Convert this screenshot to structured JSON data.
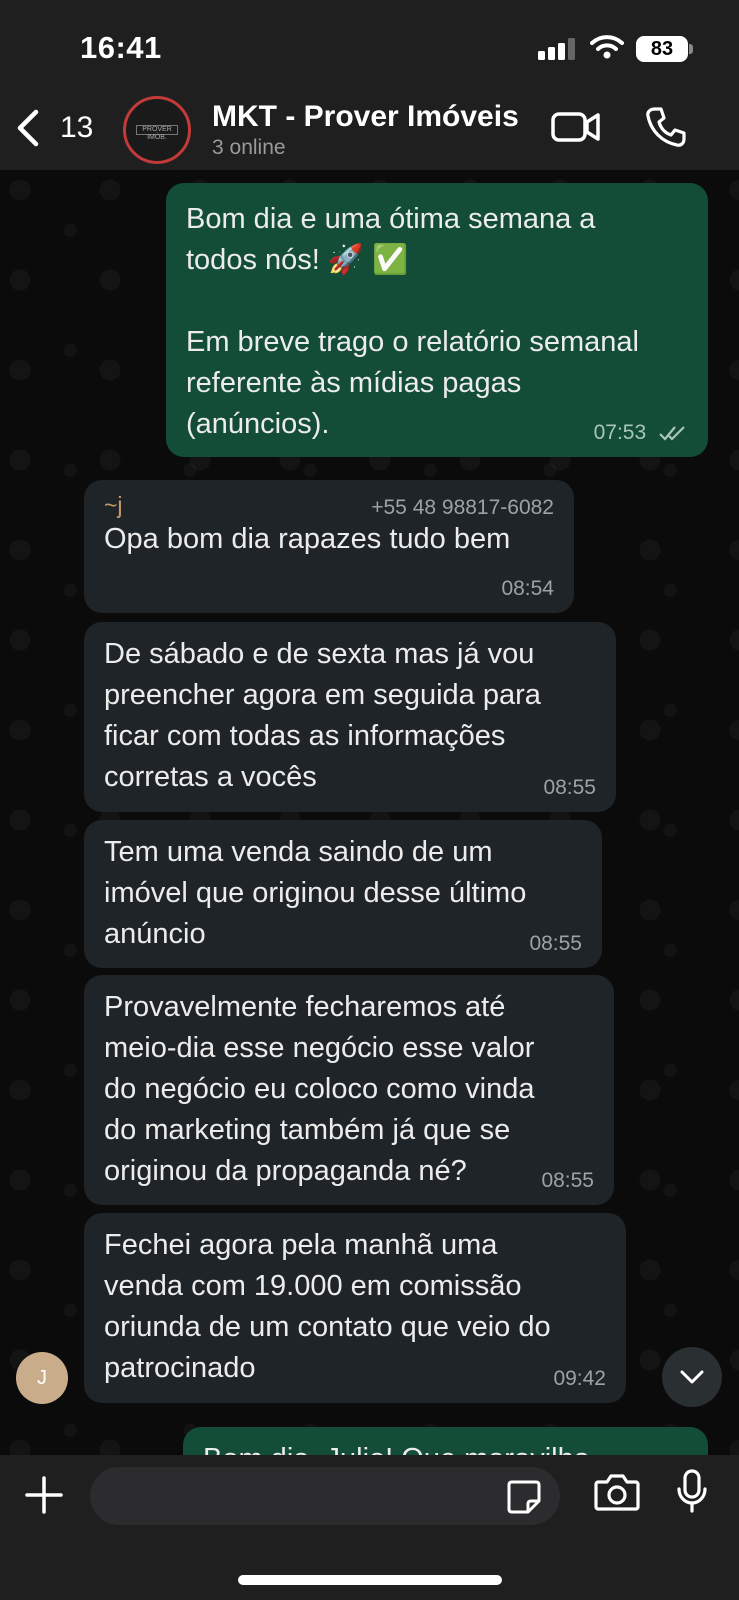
{
  "status_bar": {
    "time": "16:41",
    "battery": "83"
  },
  "header": {
    "back_count": "13",
    "title": "MKT - Prover Imóveis",
    "subtitle": "3 online",
    "avatar_logo_text": "PROVER IMÓB."
  },
  "messages": [
    {
      "dir": "out",
      "text": "Bom dia e uma ótima semana a\ntodos nós! 🚀 ✅\n\nEm breve trago o relatório semanal\nreferente às mídias pagas\n(anúncios).",
      "time": "07:53"
    },
    {
      "dir": "in",
      "sender": "~j",
      "phone": "+55 48 98817-6082",
      "text": "Opa bom dia rapazes tudo bem",
      "time": "08:54"
    },
    {
      "dir": "in",
      "text": "De sábado e de sexta mas já vou\npreencher agora em seguida para\nficar com todas as informações\ncorretas a vocês",
      "time": "08:55"
    },
    {
      "dir": "in",
      "text": "Tem uma venda saindo de um\nimóvel que originou desse último\nanúncio",
      "time": "08:55"
    },
    {
      "dir": "in",
      "text": "Provavelmente fecharemos até\nmeio-dia esse negócio esse valor\ndo negócio eu coloco como vinda\ndo marketing também já que se\noriginou da propaganda né?",
      "time": "08:55"
    },
    {
      "dir": "in",
      "text": "Fechei agora pela manhã uma\nvenda com 19.000 em comissão\noriunda de um contato que veio do\npatrocinado",
      "time": "09:42"
    }
  ],
  "sender_avatar_initial": "J",
  "partial_message_text": "Bom dia, Julio! Que maravilha",
  "icons": [
    "back-chevron-icon",
    "video-call-icon",
    "phone-call-icon",
    "plus-icon",
    "sticker-icon",
    "camera-icon",
    "microphone-icon",
    "scroll-down-icon",
    "double-check-icon"
  ],
  "colors": {
    "outgoing_bubble": "#144d37",
    "incoming_bubble": "#1f2428",
    "sender_name": "#c79a6a",
    "avatar_ring": "#c23a3a"
  }
}
